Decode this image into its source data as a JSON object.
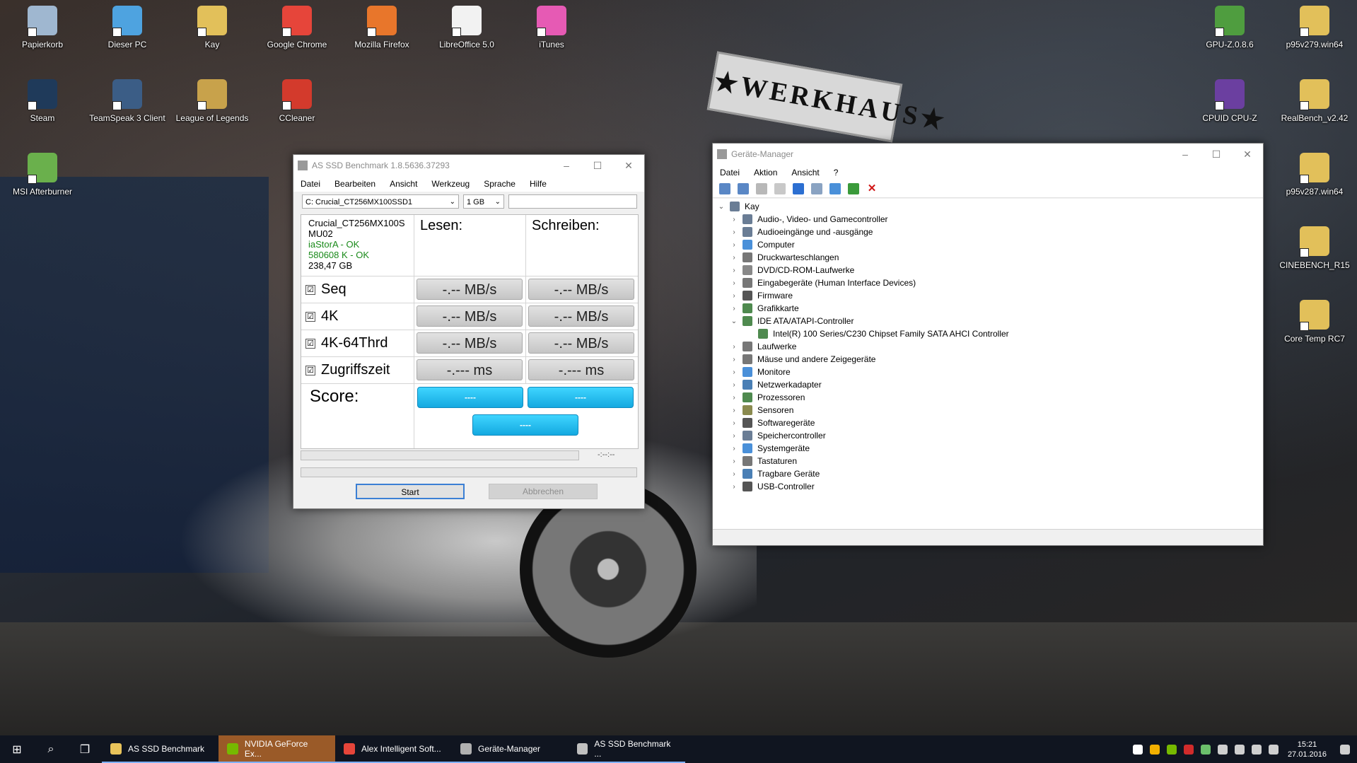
{
  "desktop": {
    "icons_left": [
      {
        "label": "Papierkorb",
        "color": "#9fb7d0"
      },
      {
        "label": "Dieser PC",
        "color": "#4ea3e0"
      },
      {
        "label": "Kay",
        "color": "#e2c05a"
      },
      {
        "label": "Google Chrome",
        "color": "#e6453a"
      },
      {
        "label": "Mozilla Firefox",
        "color": "#e8762b"
      },
      {
        "label": "LibreOffice 5.0",
        "color": "#f2f2f2"
      },
      {
        "label": "iTunes",
        "color": "#e65ab4"
      },
      {
        "label": "Steam",
        "color": "#1f3a5a"
      },
      {
        "label": "TeamSpeak 3 Client",
        "color": "#3b5d86"
      },
      {
        "label": "League of Legends",
        "color": "#c8a24b"
      },
      {
        "label": "CCleaner",
        "color": "#d33a2c"
      },
      {
        "label": "MSI Afterburner",
        "color": "#6ab04c"
      }
    ],
    "icons_right": [
      {
        "label": "GPU-Z.0.8.6",
        "color": "#4f9d3f"
      },
      {
        "label": "p95v279.win64",
        "color": "#e2c05a"
      },
      {
        "label": "CPUID CPU-Z",
        "color": "#6b3fa0"
      },
      {
        "label": "RealBench_v2.42",
        "color": "#e2c05a"
      },
      {
        "label": "p95v287.win64",
        "color": "#e2c05a"
      },
      {
        "label": "CINEBENCH_R15",
        "color": "#e2c05a"
      },
      {
        "label": "Core Temp RC7",
        "color": "#e2c05a"
      }
    ]
  },
  "asssd": {
    "title": "AS SSD Benchmark 1.8.5636.37293",
    "menu": [
      "Datei",
      "Bearbeiten",
      "Ansicht",
      "Werkzeug",
      "Sprache",
      "Hilfe"
    ],
    "drive_select": "C: Crucial_CT256MX100SSD1",
    "size_select": "1 GB",
    "device_info": {
      "model": "Crucial_CT256MX100S",
      "firmware": "MU02",
      "driver": "iaStorA - OK",
      "alignment": "580608 K - OK",
      "capacity": "238,47 GB"
    },
    "col_read": "Lesen:",
    "col_write": "Schreiben:",
    "rows": [
      {
        "label": "Seq",
        "checked": "☑",
        "read": "-.-- MB/s",
        "write": "-.-- MB/s"
      },
      {
        "label": "4K",
        "checked": "☑",
        "read": "-.-- MB/s",
        "write": "-.-- MB/s"
      },
      {
        "label": "4K-64Thrd",
        "checked": "☑",
        "read": "-.-- MB/s",
        "write": "-.-- MB/s"
      },
      {
        "label": "Zugriffszeit",
        "checked": "☑",
        "read": "-.--- ms",
        "write": "-.--- ms"
      }
    ],
    "score_label": "Score:",
    "score_read": "----",
    "score_write": "----",
    "score_total": "----",
    "time": "-:--:--",
    "start": "Start",
    "abort": "Abbrechen",
    "accent": "#1fb8ef"
  },
  "devmgr": {
    "title": "Geräte-Manager",
    "menu": [
      "Datei",
      "Aktion",
      "Ansicht",
      "?"
    ],
    "root": "Kay",
    "items": [
      {
        "label": "Audio-, Video- und Gamecontroller",
        "exp": "›",
        "color": "#6a7d95"
      },
      {
        "label": "Audioeingänge und -ausgänge",
        "exp": "›",
        "color": "#6a7d95"
      },
      {
        "label": "Computer",
        "exp": "›",
        "color": "#4a90d9"
      },
      {
        "label": "Druckwarteschlangen",
        "exp": "›",
        "color": "#777"
      },
      {
        "label": "DVD/CD-ROM-Laufwerke",
        "exp": "›",
        "color": "#888"
      },
      {
        "label": "Eingabegeräte (Human Interface Devices)",
        "exp": "›",
        "color": "#777"
      },
      {
        "label": "Firmware",
        "exp": "›",
        "color": "#555"
      },
      {
        "label": "Grafikkarte",
        "exp": "›",
        "color": "#4f8a4f"
      },
      {
        "label": "IDE ATA/ATAPI-Controller",
        "exp": "⌄",
        "color": "#4f8a4f"
      },
      {
        "label": "Intel(R) 100 Series/C230 Chipset Family SATA AHCI Controller",
        "exp": "",
        "color": "#4f8a4f",
        "child": true
      },
      {
        "label": "Laufwerke",
        "exp": "›",
        "color": "#777"
      },
      {
        "label": "Mäuse und andere Zeigegeräte",
        "exp": "›",
        "color": "#777"
      },
      {
        "label": "Monitore",
        "exp": "›",
        "color": "#4a90d9"
      },
      {
        "label": "Netzwerkadapter",
        "exp": "›",
        "color": "#4a7fb5"
      },
      {
        "label": "Prozessoren",
        "exp": "›",
        "color": "#4f8a4f"
      },
      {
        "label": "Sensoren",
        "exp": "›",
        "color": "#8a8a4f"
      },
      {
        "label": "Softwaregeräte",
        "exp": "›",
        "color": "#555"
      },
      {
        "label": "Speichercontroller",
        "exp": "›",
        "color": "#6a7d95"
      },
      {
        "label": "Systemgeräte",
        "exp": "›",
        "color": "#4a90d9"
      },
      {
        "label": "Tastaturen",
        "exp": "›",
        "color": "#777"
      },
      {
        "label": "Tragbare Geräte",
        "exp": "›",
        "color": "#4a7fb5"
      },
      {
        "label": "USB-Controller",
        "exp": "›",
        "color": "#555"
      }
    ]
  },
  "taskbar": {
    "items": [
      {
        "label": "AS SSD Benchmark",
        "color": "#e8c35a",
        "active": false
      },
      {
        "label": "NVIDIA GeForce Ex...",
        "color": "#76b900",
        "active": true
      },
      {
        "label": "Alex Intelligent Soft...",
        "color": "#e6453a",
        "active": false
      },
      {
        "label": "Geräte-Manager",
        "color": "#b0b0b0",
        "active": false
      },
      {
        "label": "AS SSD Benchmark ...",
        "color": "#c0c0c0",
        "active": false
      }
    ],
    "time": "15:21",
    "date": "27.01.2016"
  }
}
